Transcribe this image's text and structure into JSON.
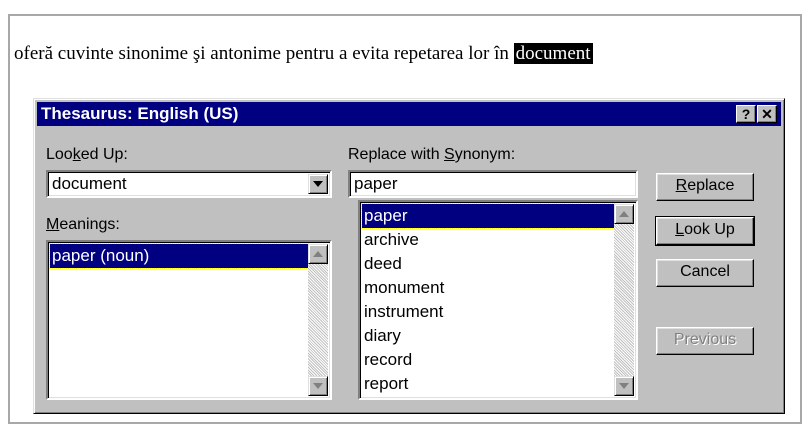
{
  "document": {
    "sentence": "oferă cuvinte sinonime şi antonime pentru a evita repetarea lor în ",
    "selected_word": "document"
  },
  "dialog": {
    "title": "Thesaurus: English (US)",
    "help_glyph": "?",
    "close_glyph": "✕",
    "looked_up": {
      "label_pre": "Loo",
      "label_accel": "k",
      "label_post": "ed Up:",
      "value": "document"
    },
    "meanings": {
      "label_pre": "",
      "label_accel": "M",
      "label_post": "eanings:",
      "items": [
        "paper (noun)"
      ]
    },
    "replace_with": {
      "label_pre": "Replace with ",
      "label_accel": "S",
      "label_post": "ynonym:",
      "value": "paper",
      "items": [
        "paper",
        "archive",
        "deed",
        "monument",
        "instrument",
        "diary",
        "record",
        "report"
      ]
    },
    "buttons": {
      "replace_accel": "R",
      "replace_rest": "eplace",
      "lookup_accel": "L",
      "lookup_rest": "ook Up",
      "cancel": "Cancel",
      "previous": "Previous"
    }
  },
  "colors": {
    "titlebar": "#000080",
    "face": "#c0c0c0",
    "selection": "#000080"
  },
  "icons": {
    "help": "question-mark",
    "close": "close-x",
    "dropdown": "chevron-down",
    "scroll_up": "triangle-up",
    "scroll_down": "triangle-down"
  }
}
